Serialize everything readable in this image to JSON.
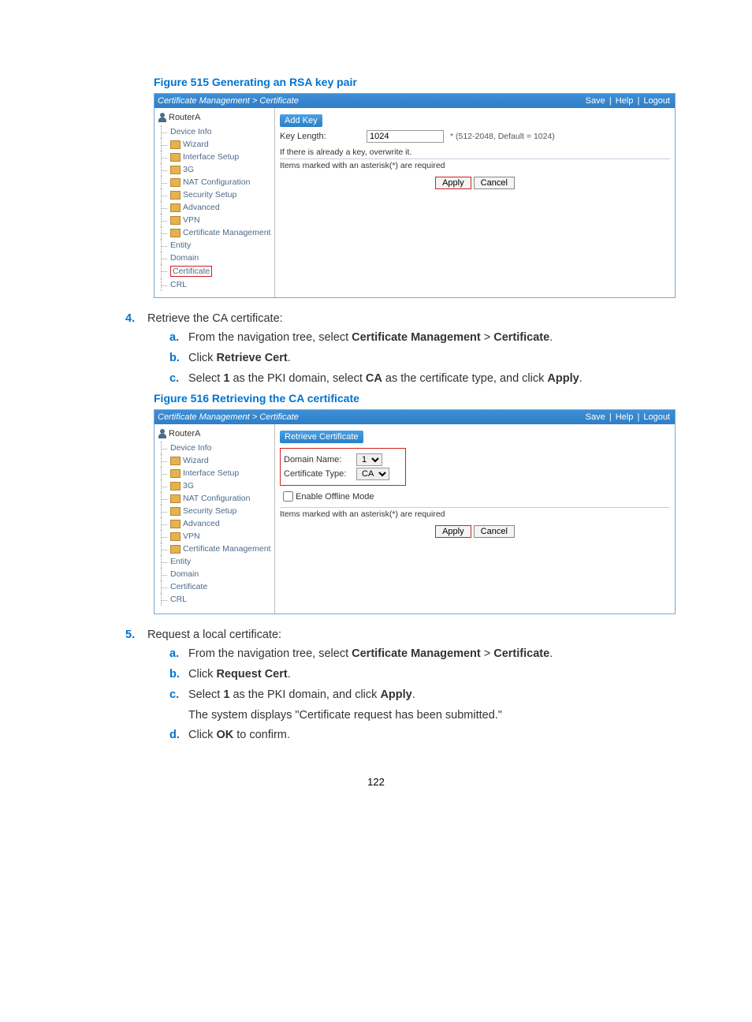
{
  "figure515": {
    "title": "Figure 515 Generating an RSA key pair",
    "breadcrumb": "Certificate Management > Certificate",
    "topLinks": {
      "save": "Save",
      "help": "Help",
      "logout": "Logout"
    },
    "root": "RouterA",
    "nav": {
      "deviceInfo": "Device Info",
      "wizard": "Wizard",
      "interfaceSetup": "Interface Setup",
      "g3": "3G",
      "natConfig": "NAT Configuration",
      "securitySetup": "Security Setup",
      "advanced": "Advanced",
      "vpn": "VPN",
      "certMgmt": "Certificate Management",
      "entity": "Entity",
      "domain": "Domain",
      "certificate": "Certificate",
      "crl": "CRL"
    },
    "form": {
      "header": "Add Key",
      "keyLengthLabel": "Key Length:",
      "keyLengthValue": "1024",
      "keyLengthHint": "* (512-2048, Default = 1024)",
      "overwrite": "If there is already a key, overwrite it.",
      "required": "Items marked with an asterisk(*) are required",
      "apply": "Apply",
      "cancel": "Cancel"
    }
  },
  "step4": {
    "num": "4.",
    "title": "Retrieve the CA certificate:",
    "a_letter": "a.",
    "a_text_before": "From the navigation tree, select ",
    "a_b1": "Certificate Management",
    "a_gt": " > ",
    "a_b2": "Certificate",
    "a_after": ".",
    "b_letter": "b.",
    "b_text": "Click ",
    "b_bold": "Retrieve Cert",
    "b_after": ".",
    "c_letter": "c.",
    "c_text1": "Select ",
    "c_b1": "1",
    "c_text2": " as the PKI domain, select ",
    "c_b2": "CA",
    "c_text3": " as the certificate type, and click ",
    "c_b3": "Apply",
    "c_text4": "."
  },
  "figure516": {
    "title": "Figure 516 Retrieving the CA certificate",
    "breadcrumb": "Certificate Management > Certificate",
    "form": {
      "header": "Retrieve Certificate",
      "domainLabel": "Domain Name:",
      "domainValue": "1",
      "certTypeLabel": "Certificate Type:",
      "certTypeValue": "CA",
      "enableOffline": "Enable Offline Mode",
      "required": "Items marked with an asterisk(*) are required",
      "apply": "Apply",
      "cancel": "Cancel"
    }
  },
  "step5": {
    "num": "5.",
    "title": "Request a local certificate:",
    "a_letter": "a.",
    "a_text_before": "From the navigation tree, select ",
    "a_b1": "Certificate Management",
    "a_gt": " > ",
    "a_b2": "Certificate",
    "a_after": ".",
    "b_letter": "b.",
    "b_text": "Click ",
    "b_bold": "Request Cert",
    "b_after": ".",
    "c_letter": "c.",
    "c_text1": "Select ",
    "c_b1": "1",
    "c_text2": " as the PKI domain, and click ",
    "c_b2": "Apply",
    "c_text3": ".",
    "c_followup": "The system displays \"Certificate request has been submitted.\"",
    "d_letter": "d.",
    "d_text": "Click ",
    "d_bold": "OK",
    "d_after": " to confirm."
  },
  "pageNumber": "122"
}
